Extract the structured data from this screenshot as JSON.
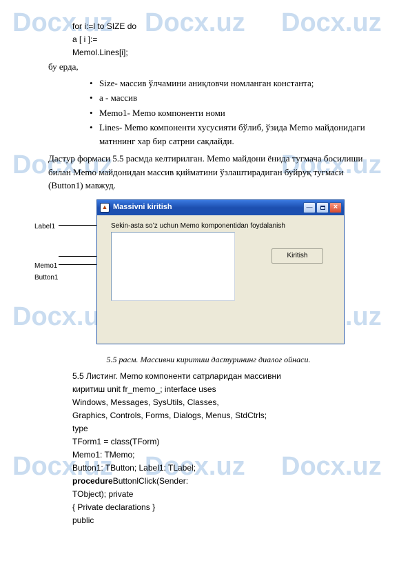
{
  "watermark": "Docx.uz",
  "code": {
    "l1": "for i:=l to SIZE do",
    "l2": "a [ i ]:=",
    "l3": "Memol.Lines[i];"
  },
  "here": "бу ерда,",
  "bullets": {
    "b1": "Size- массив ўлчамини аниқловчи номланган константа;",
    "b2": "a - массив",
    "b3": "Memo1- Memo компоненти номи",
    "b4": "Lines- Memo компоненти хусусияти бўлиб, ўзида Memo майдонидаги матннинг хар бир сатрни сақлайди."
  },
  "para1": "Дастур формаси 5.5 расмда келтирилган. Memo майдони ёнида тугмача босилиши билан Memo майдонидан массив қийматини ўзлаштирадиган буйруқ тугмаси (Button1) мавжуд.",
  "figure": {
    "side": {
      "label1": "Label1",
      "memo": "Memo1",
      "button": "Button1"
    },
    "title": "Massivni kiritish",
    "formLabel": "Sekin-asta soʻz uchun Memo komponentidan foydalanish",
    "button": "Kiritish"
  },
  "caption": "5.5 расм. Массивни киритиш дастурининг диалог ойнаси.",
  "listing": {
    "l1": "5.5 Листинг. Memo компоненти сатрларидан массивни",
    "l2": "киритиш unit fr_memo_; interface uses",
    "l3": "Windows, Messages, SysUtils, Classes,",
    "l4": "Graphics, Controls, Forms, Dialogs, Menus, StdCtrls;",
    "l5": "type",
    "l6": "TForm1 = class(TForm)",
    "l7": "Memo1: TMemo;",
    "l8": "Button1: TButton; Label1: TLabel;",
    "l9a": "procedure",
    "l9b": "ButtonlClick(Sender:",
    "l10": "TObject); private",
    "l11": "{ Private declarations }",
    "l12": "public"
  }
}
